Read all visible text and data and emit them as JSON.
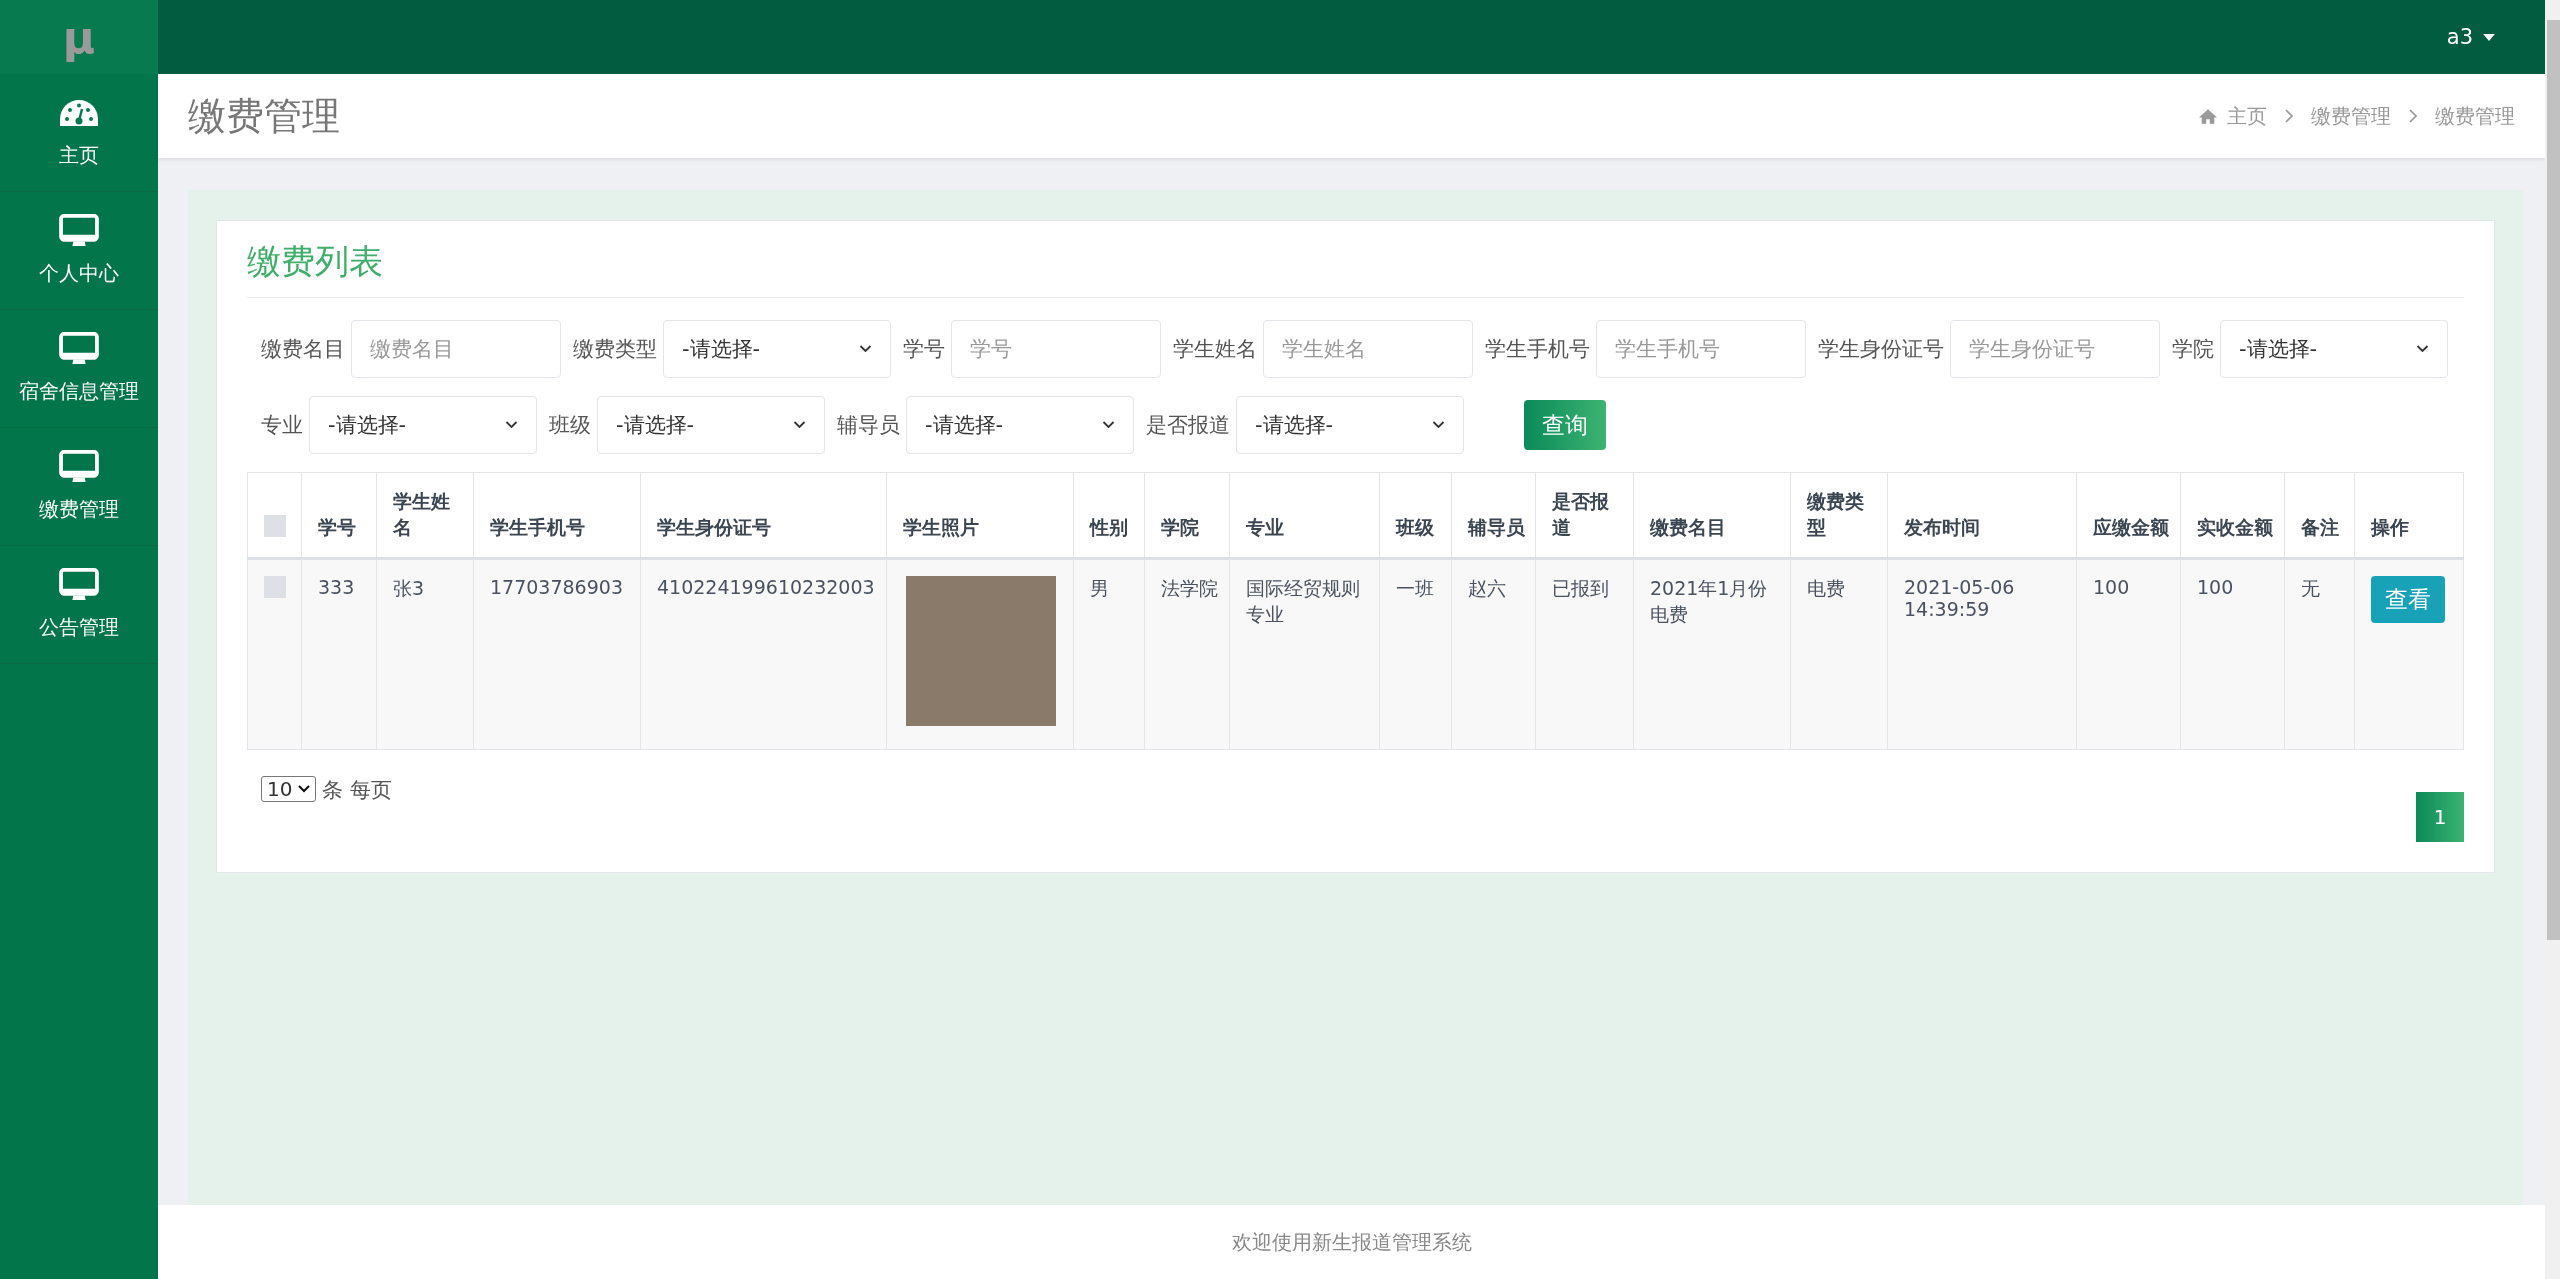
{
  "logo": "μ",
  "user": {
    "name": "a3"
  },
  "sidebar": {
    "items": [
      {
        "label": "主页",
        "kind": "dashboard"
      },
      {
        "label": "个人中心",
        "kind": "monitor"
      },
      {
        "label": "宿舍信息管理",
        "kind": "monitor"
      },
      {
        "label": "缴费管理",
        "kind": "monitor"
      },
      {
        "label": "公告管理",
        "kind": "monitor"
      }
    ]
  },
  "header": {
    "title": "缴费管理",
    "breadcrumb": [
      "主页",
      "缴费管理",
      "缴费管理"
    ]
  },
  "card": {
    "title": "缴费列表"
  },
  "filters": {
    "rows": [
      [
        {
          "label": "缴费名目",
          "kind": "input",
          "placeholder": "缴费名目"
        },
        {
          "label": "缴费类型",
          "kind": "select",
          "value": "-请选择-"
        },
        {
          "label": "学号",
          "kind": "input",
          "placeholder": "学号"
        },
        {
          "label": "学生姓名",
          "kind": "input",
          "placeholder": "学生姓名"
        },
        {
          "label": "学生手机号",
          "kind": "input",
          "placeholder": "学生手机号"
        },
        {
          "label": "学生身份证号",
          "kind": "input",
          "placeholder": "学生身份证号"
        },
        {
          "label": "学院",
          "kind": "select",
          "value": "-请选择-"
        }
      ],
      [
        {
          "label": "专业",
          "kind": "select",
          "value": "-请选择-"
        },
        {
          "label": "班级",
          "kind": "select",
          "value": "-请选择-"
        },
        {
          "label": "辅导员",
          "kind": "select",
          "value": "-请选择-"
        },
        {
          "label": "是否报道",
          "kind": "select",
          "value": "-请选择-"
        }
      ]
    ],
    "search_button": "查询"
  },
  "table": {
    "header_checked": false,
    "columns": [
      "学号",
      "学生姓名",
      "学生手机号",
      "学生身份证号",
      "学生照片",
      "性别",
      "学院",
      "专业",
      "班级",
      "辅导员",
      "是否报道",
      "缴费名目",
      "缴费类型",
      "发布时间",
      "应缴金额",
      "实收金额",
      "备注",
      "操作"
    ],
    "rows": [
      {
        "checked": false,
        "cells": [
          "333",
          "张3",
          "17703786903",
          "410224199610232003",
          null,
          "男",
          "法学院",
          "国际经贸规则专业",
          "一班",
          "赵六",
          "已报到",
          "2021年1月份电费",
          "电费",
          "2021-05-06 14:39:59",
          "100",
          "100",
          "无"
        ],
        "action": "查看"
      }
    ]
  },
  "pagination": {
    "page_size": "10",
    "page_size_label": "条 每页",
    "pages": [
      {
        "label": "1",
        "selected": true
      }
    ]
  },
  "footer": "欢迎使用新生报道管理系统"
}
